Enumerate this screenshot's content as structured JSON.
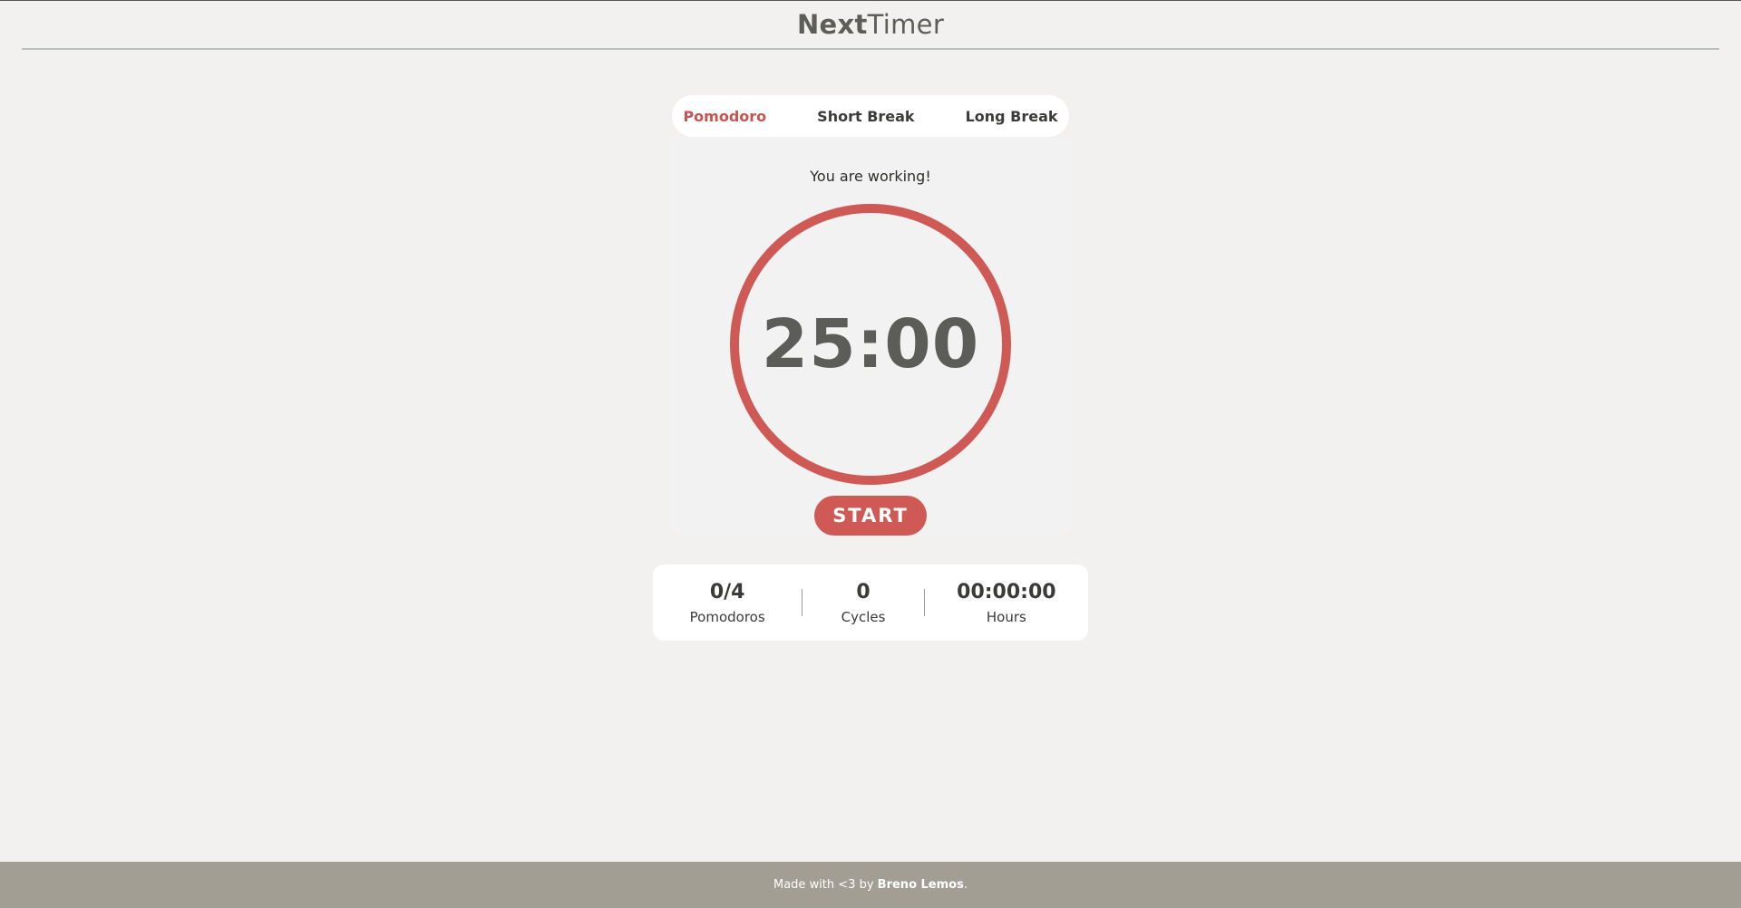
{
  "header": {
    "brand_part1": "Next",
    "brand_part2": "Timer"
  },
  "tabs": [
    {
      "label": "Pomodoro",
      "active": true
    },
    {
      "label": "Short Break",
      "active": false
    },
    {
      "label": "Long Break",
      "active": false
    }
  ],
  "timer": {
    "status": "You are working!",
    "time": "25:00",
    "start_label": "START",
    "ring_progress": 1.0
  },
  "stats": [
    {
      "value": "0/4",
      "label": "Pomodoros"
    },
    {
      "value": "0",
      "label": "Cycles"
    },
    {
      "value": "00:00:00",
      "label": "Hours"
    }
  ],
  "footer": {
    "prefix": "Made with <3 by ",
    "author": "Breno Lemos",
    "suffix": "."
  },
  "colors": {
    "accent": "#cf5a55",
    "background": "#f2f1ef",
    "footer_bg": "#a29e93"
  }
}
